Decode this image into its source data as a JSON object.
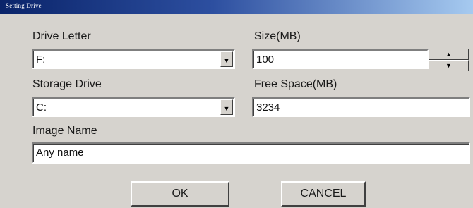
{
  "window": {
    "title": "Setting Drive"
  },
  "drive_letter": {
    "label": "Drive Letter",
    "value": "F:"
  },
  "size": {
    "label": "Size(MB)",
    "value": "100"
  },
  "storage_drive": {
    "label": "Storage Drive",
    "value": "C:"
  },
  "free_space": {
    "label": "Free Space(MB)",
    "value": "3234"
  },
  "image_name": {
    "label": "Image Name",
    "value": "Any name"
  },
  "buttons": {
    "ok": "OK",
    "cancel": "CANCEL"
  },
  "icons": {
    "dropdown": "chevron-down-icon",
    "spin_up": "arrow-up-icon",
    "spin_down": "arrow-down-icon"
  },
  "colors": {
    "titlebar_start": "#0a246a",
    "titlebar_end": "#a6caf0",
    "face": "#d6d3ce"
  }
}
